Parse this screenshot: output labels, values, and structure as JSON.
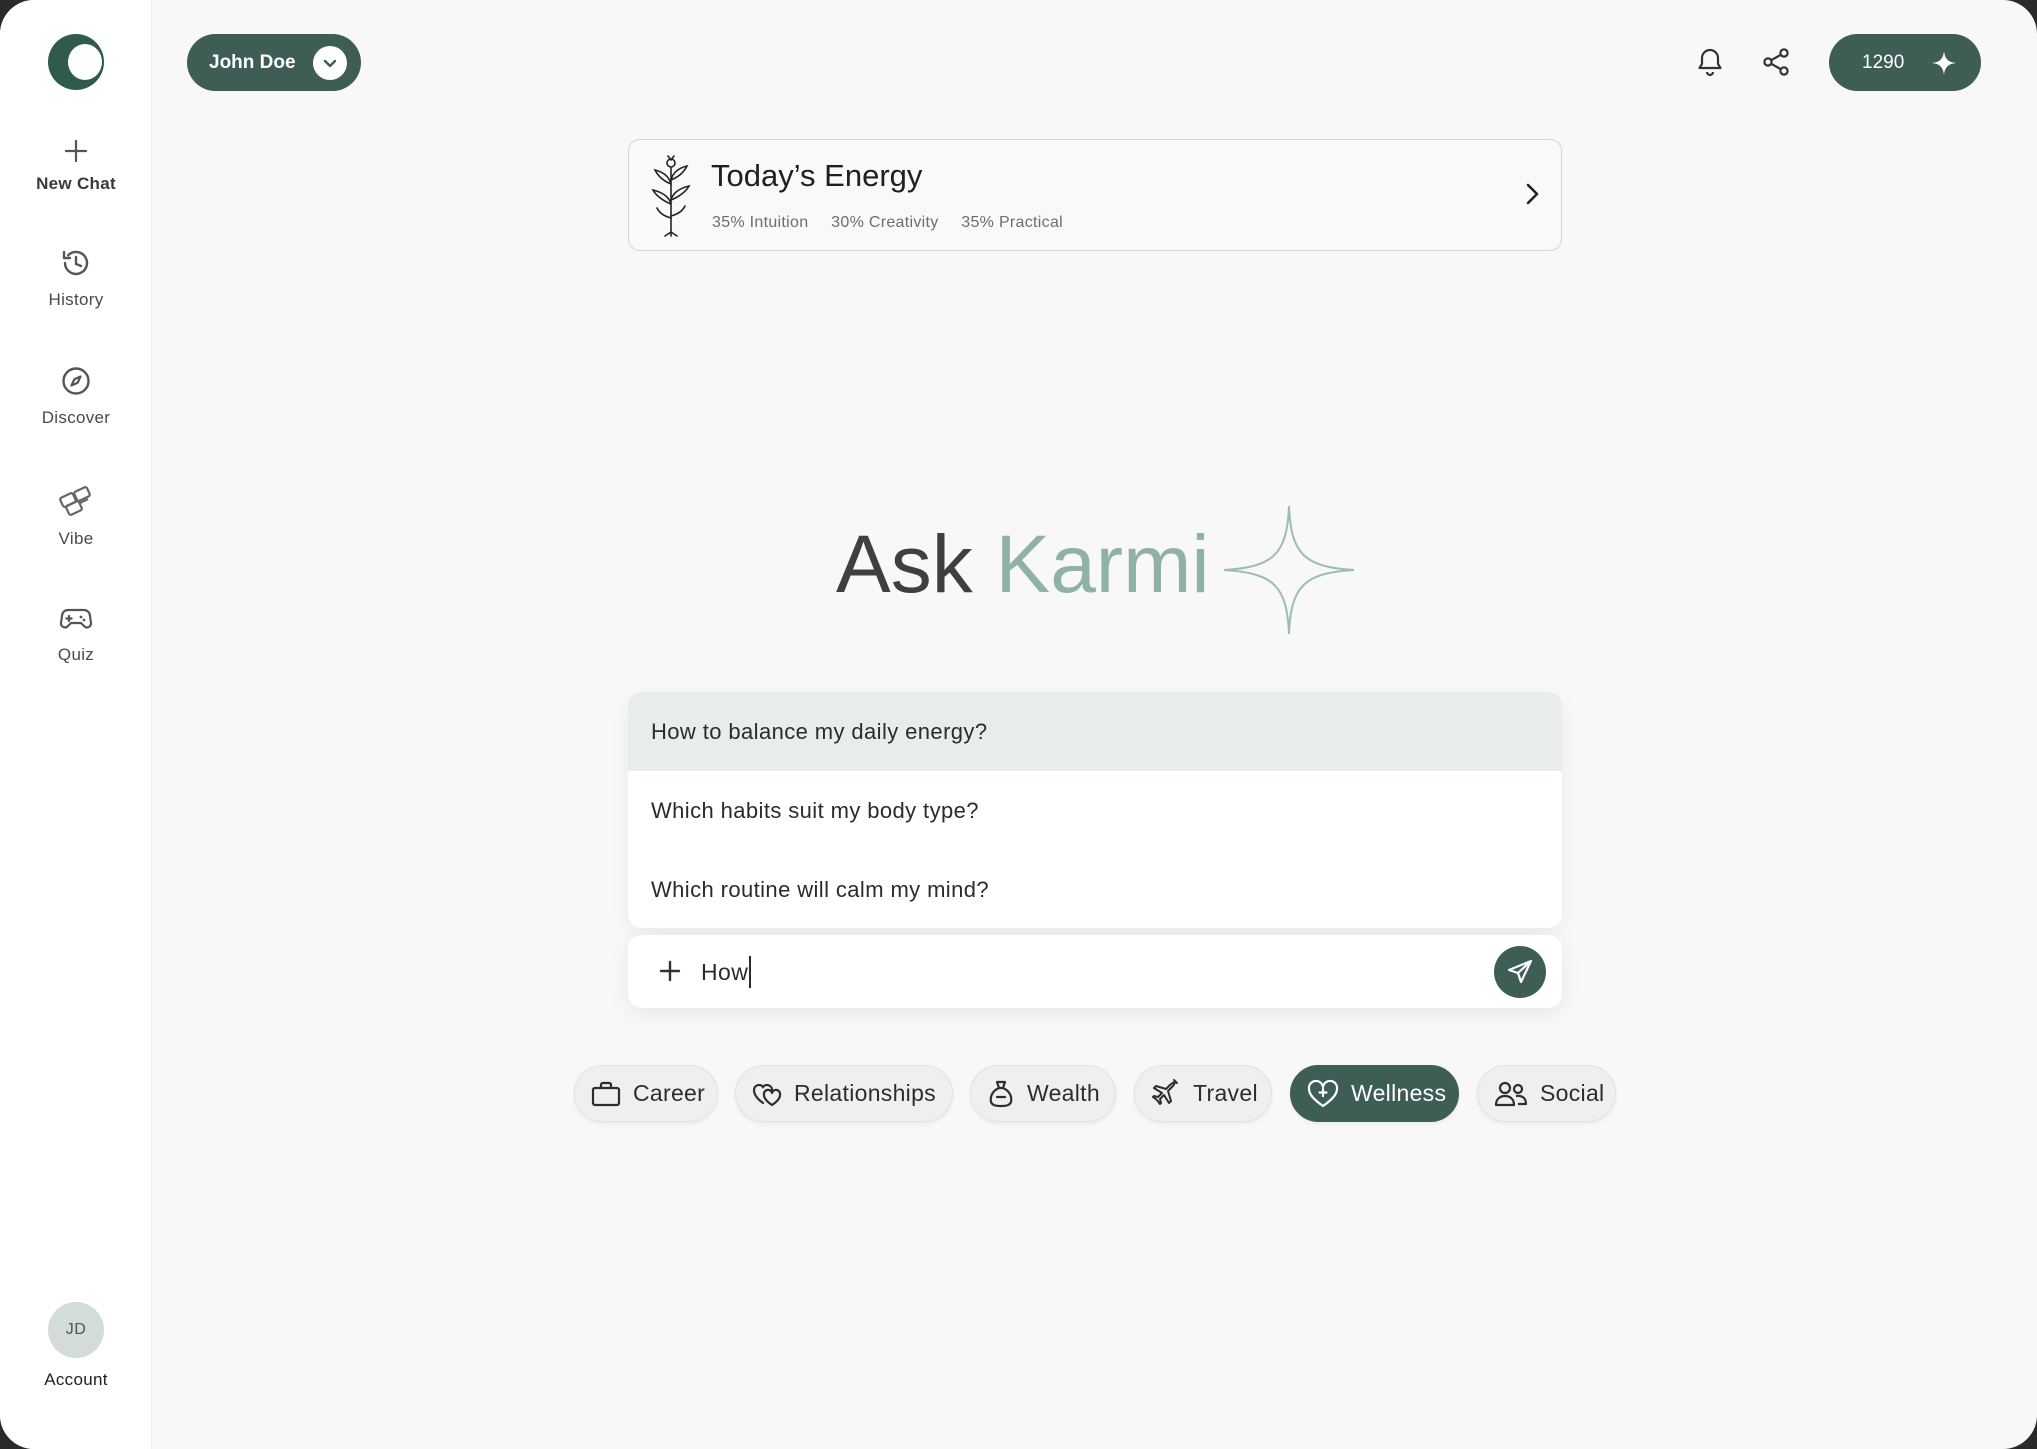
{
  "sidebar": {
    "items": [
      {
        "label": "New Chat",
        "icon": "plus-icon"
      },
      {
        "label": "History",
        "icon": "history-icon"
      },
      {
        "label": "Discover",
        "icon": "compass-icon"
      },
      {
        "label": "Vibe",
        "icon": "vibe-icon"
      },
      {
        "label": "Quiz",
        "icon": "gamepad-icon"
      }
    ],
    "account": {
      "initials": "JD",
      "label": "Account"
    }
  },
  "header": {
    "user_name": "John Doe",
    "credits": "1290"
  },
  "energy": {
    "title": "Today’s Energy",
    "stats": [
      "35% Intuition",
      "30% Creativity",
      "35% Practical"
    ]
  },
  "headline": {
    "word1": "Ask",
    "word2": "Karmi"
  },
  "suggestions": [
    "How to balance my daily energy?",
    "Which habits suit my body type?",
    "Which routine will calm my mind?"
  ],
  "input": {
    "value": "How"
  },
  "categories": [
    {
      "label": "Career",
      "icon": "briefcase-icon",
      "selected": false
    },
    {
      "label": "Relationships",
      "icon": "hearts-icon",
      "selected": false
    },
    {
      "label": "Wealth",
      "icon": "money-bag-icon",
      "selected": false
    },
    {
      "label": "Travel",
      "icon": "airplane-icon",
      "selected": false
    },
    {
      "label": "Wellness",
      "icon": "heart-plus-icon",
      "selected": true
    },
    {
      "label": "Social",
      "icon": "people-icon",
      "selected": false
    }
  ],
  "colors": {
    "accent": "#3e5d55",
    "accent_light": "#8fb1a6",
    "background": "#f8f8f8"
  }
}
